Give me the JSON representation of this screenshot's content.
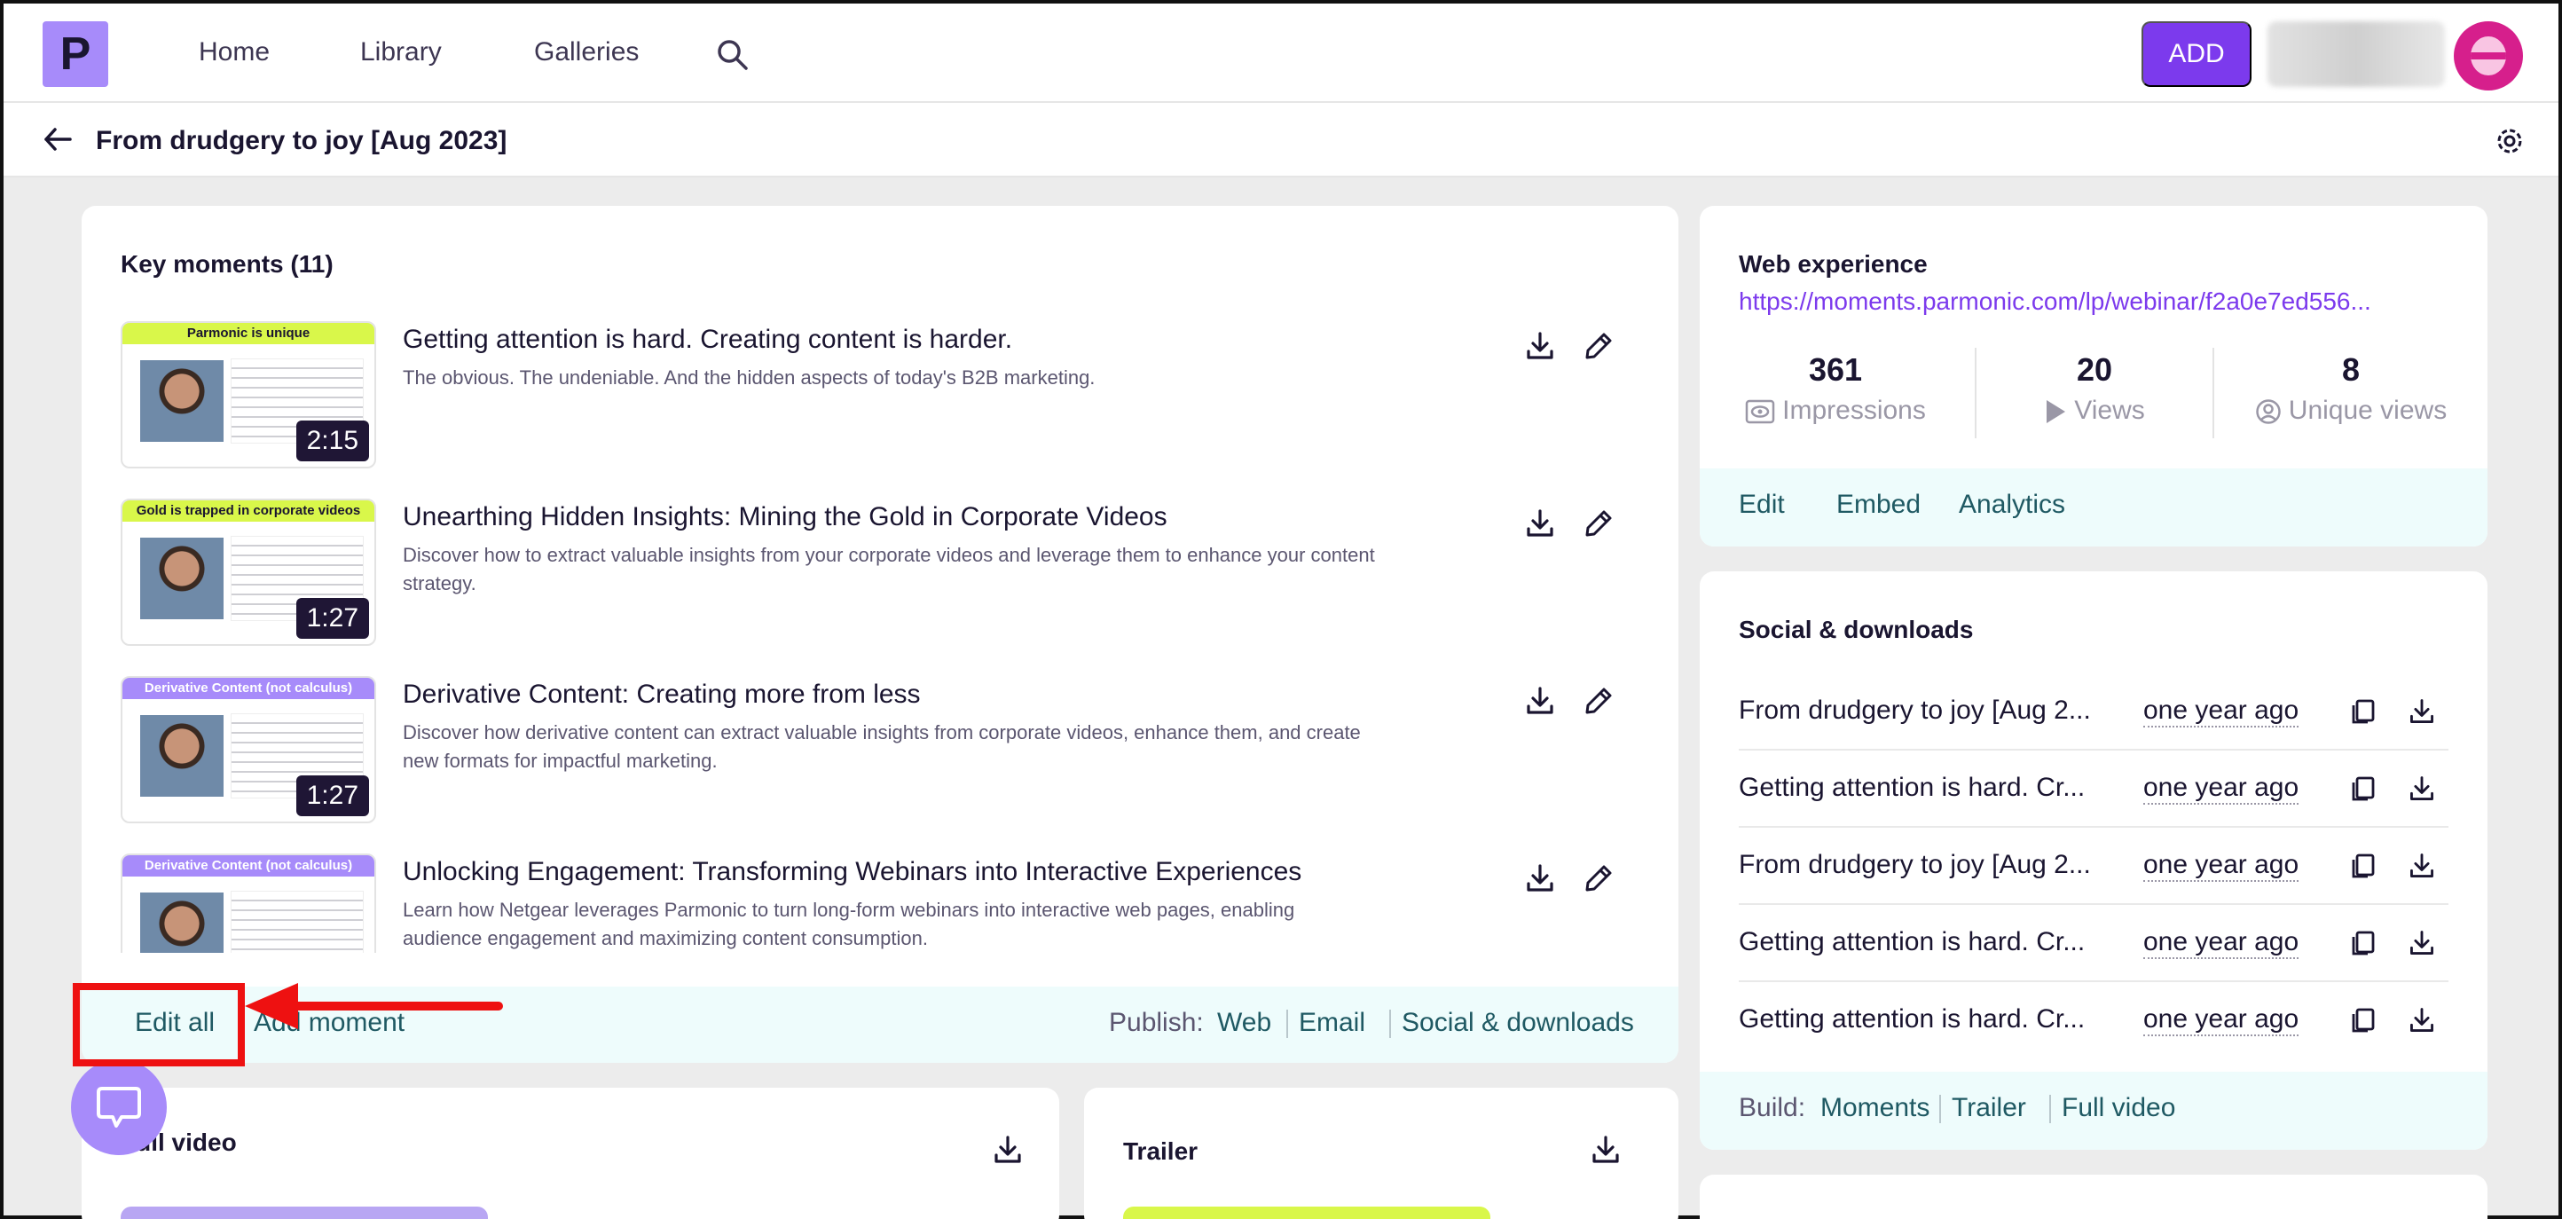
{
  "nav": {
    "logo_letter": "P",
    "links": [
      "Home",
      "Library",
      "Galleries"
    ],
    "add_label": "ADD"
  },
  "page": {
    "title": "From drudgery to joy [Aug 2023]"
  },
  "key_moments": {
    "title": "Key moments (11)",
    "items": [
      {
        "thumb_banner": "Parmonic is unique",
        "duration": "2:15",
        "title": "Getting attention is hard. Creating content is harder.",
        "desc": "The obvious. The undeniable. And the hidden aspects of today's B2B marketing."
      },
      {
        "thumb_banner": "Gold is trapped in corporate videos",
        "duration": "1:27",
        "title": "Unearthing Hidden Insights: Mining the Gold in Corporate Videos",
        "desc": "Discover how to extract valuable insights from your corporate videos and leverage them to enhance your content strategy."
      },
      {
        "thumb_banner": "Derivative Content (not calculus)",
        "duration": "1:27",
        "title": "Derivative Content: Creating more from less",
        "desc": "Discover how derivative content can extract valuable insights from corporate videos, enhance them, and create new formats for impactful marketing."
      },
      {
        "thumb_banner": "Derivative Content (not calculus)",
        "duration": "",
        "title": "Unlocking Engagement: Transforming Webinars into Interactive Experiences",
        "desc": "Learn how Netgear leverages Parmonic to turn long-form webinars into interactive web pages, enabling audience engagement and maximizing content consumption."
      }
    ],
    "footer": {
      "edit_all": "Edit all",
      "add_moment": "Add moment",
      "publish_label": "Publish:",
      "publish_links": [
        "Web",
        "Email",
        "Social & downloads"
      ]
    }
  },
  "web_experience": {
    "title": "Web experience",
    "url": "https://moments.parmonic.com/lp/webinar/f2a0e7ed556...",
    "stats": [
      {
        "value": "361",
        "label": "Impressions",
        "icon": "eye-icon"
      },
      {
        "value": "20",
        "label": "Views",
        "icon": "play-icon"
      },
      {
        "value": "8",
        "label": "Unique views",
        "icon": "user-circle-icon"
      }
    ],
    "links": [
      "Edit",
      "Embed",
      "Analytics"
    ]
  },
  "social": {
    "title": "Social & downloads",
    "rows": [
      {
        "name": "From drudgery to joy [Aug 2...",
        "time": "one year ago"
      },
      {
        "name": "Getting attention is hard. Cr...",
        "time": "one year ago"
      },
      {
        "name": "From drudgery to joy [Aug 2...",
        "time": "one year ago"
      },
      {
        "name": "Getting attention is hard. Cr...",
        "time": "one year ago"
      },
      {
        "name": "Getting attention is hard. Cr...",
        "time": "one year ago"
      }
    ],
    "build_label": "Build:",
    "build_links": [
      "Moments",
      "Trailer",
      "Full video"
    ]
  },
  "full_video": {
    "title": "Full video"
  },
  "trailer": {
    "title": "Trailer"
  },
  "colors": {
    "brand_purple": "#7c3aed",
    "logo_bg": "#a78bfa",
    "teal_link": "#1f5963",
    "footer_bg": "#eefcfc",
    "annotation_red": "#ee1111"
  }
}
